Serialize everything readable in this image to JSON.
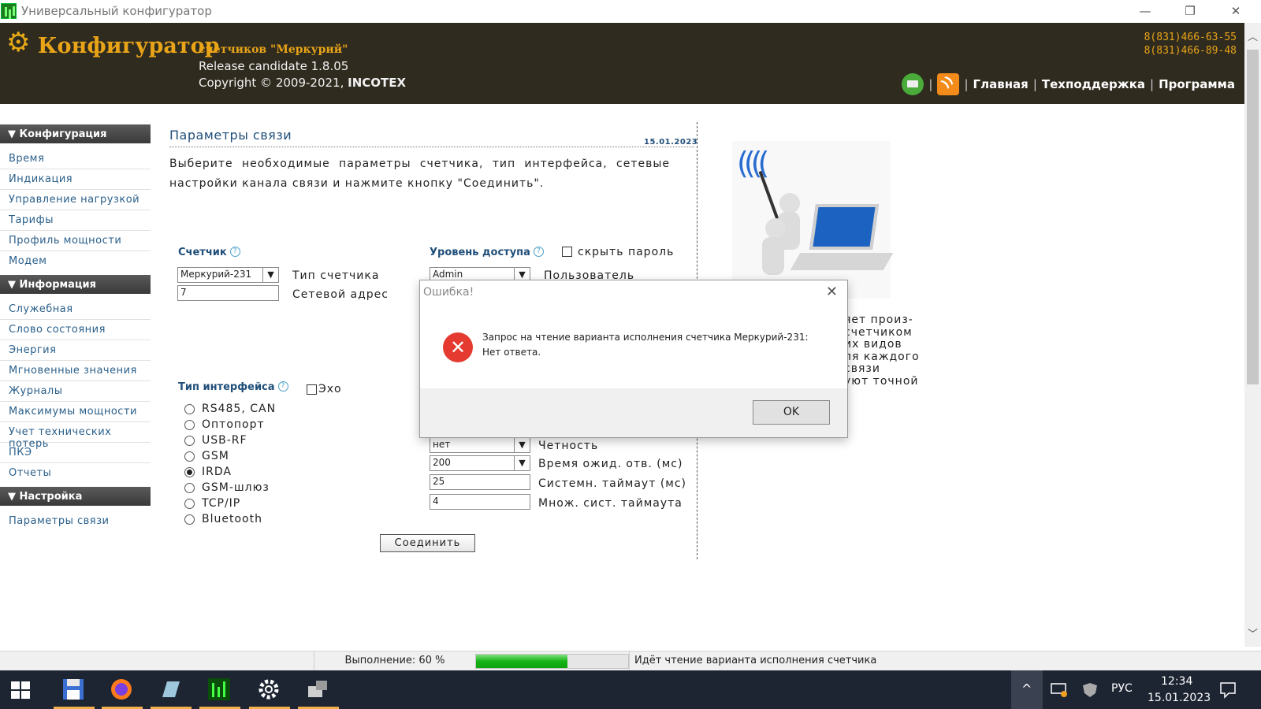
{
  "window": {
    "title": "Универсальный конфигуратор",
    "min": "—",
    "max": "❐",
    "close": "✕"
  },
  "header": {
    "brand": "Конфигуратор",
    "brand_sub": "счетчиков \"Меркурий\"",
    "release": "Release candidate 1.8.05",
    "copyright_prefix": "Copyright © 2009-2021,",
    "company": "INCOTEX",
    "phone1": "8(831)466-63-55",
    "phone2": "8(831)466-89-48",
    "nav": [
      "Главная",
      "Техподдержка",
      "Программа"
    ],
    "nav_sep": "|",
    "icons": [
      "printer-icon",
      "rss-icon"
    ],
    "brand_color": "#e9a418",
    "bg_color": "#2f2b1f"
  },
  "sidebar": {
    "sections": [
      {
        "title": "▼ Конфигурация",
        "items": [
          "Время",
          "Индикация",
          "Управление нагрузкой",
          "Тарифы",
          "Профиль мощности",
          "Модем"
        ]
      },
      {
        "title": "▼ Информация",
        "items": [
          "Служебная",
          "Слово состояния",
          "Энергия",
          "Мгновенные значения",
          "Журналы",
          "Максимумы мощности",
          "Учет технических потерь",
          "ПКЭ",
          "Отчеты"
        ]
      },
      {
        "title": "▼ Настройка",
        "items": [
          "Параметры связи"
        ]
      }
    ]
  },
  "content": {
    "title": "Параметры связи",
    "date": "15.01.2023",
    "intro": "Выберите необходимые параметры счетчика, тип интерфейса, сетевые настройки канала связи и нажмите кнопку \"Соединить\".",
    "help_glyph": "?",
    "meter": {
      "label": "Счетчик",
      "type_value": "Меркурий-231",
      "type_label": "Тип счетчика",
      "address_value": "7",
      "address_label": "Сетевой адрес"
    },
    "access": {
      "label": "Уровень доступа",
      "hide_password": "скрыть пароль",
      "user_value": "Admin",
      "user_label": "Пользователь"
    },
    "interface": {
      "label": "Тип интерфейса",
      "echo_label": "Эхо",
      "options": [
        "RS485, CAN",
        "Оптопорт",
        "USB-RF",
        "GSM",
        "IRDA",
        "GSM-шлюз",
        "TCP/IP",
        "Bluetooth"
      ],
      "selected": "IRDA"
    },
    "params": [
      {
        "value": "нет",
        "label": "Четность",
        "kind": "select"
      },
      {
        "value": "200",
        "label": "Время ожид. отв. (мс)",
        "kind": "select"
      },
      {
        "value": "25",
        "label": "Системн. таймаут (мс)",
        "kind": "input"
      },
      {
        "value": "4",
        "label": "Множ. сист. таймаута",
        "kind": "input"
      }
    ],
    "connect_button": "Соединить",
    "side_text": [
      "яет произ-",
      "счетчиком",
      "их видов",
      "ля каждого",
      "связи",
      "уют точной"
    ]
  },
  "dialog": {
    "title": "Ошибка!",
    "message_line1": "Запрос на чтение варианта исполнения счетчика Меркурий-231:",
    "message_line2": "Нет ответа.",
    "ok": "OK",
    "close": "✕",
    "icon": "error-icon",
    "icon_glyph": "✕"
  },
  "status": {
    "progress_text": "Выполнение: 60 %",
    "progress_value": 0.6,
    "message": "Идёт чтение варианта исполнения счетчика"
  },
  "taskbar": {
    "lang": "РУС",
    "time": "12:34",
    "date": "15.01.2023",
    "chevron": "^"
  }
}
